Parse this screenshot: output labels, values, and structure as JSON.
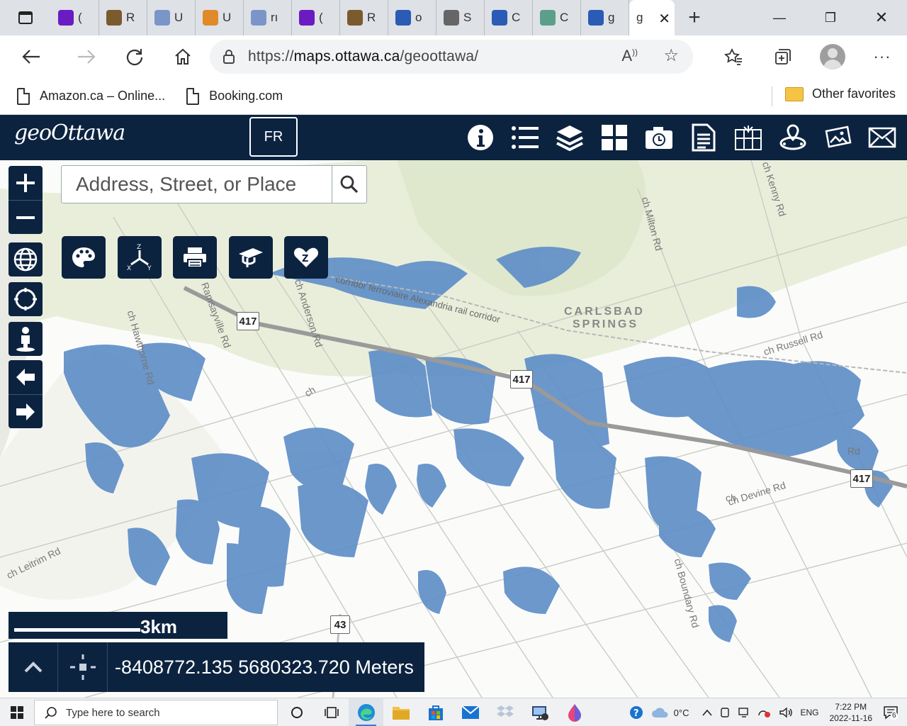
{
  "browser": {
    "tabs": [
      {
        "title": "(",
        "icon": "mail-icon",
        "color": "#6a1bc2"
      },
      {
        "title": "R",
        "icon": "crest-icon",
        "color": "#7b5a2e"
      },
      {
        "title": "U",
        "icon": "search-icon",
        "color": "#7a96c9"
      },
      {
        "title": "U",
        "icon": "sun-icon",
        "color": "#e08a2a"
      },
      {
        "title": "rı",
        "icon": "search-icon",
        "color": "#7a96c9"
      },
      {
        "title": "(",
        "icon": "mail-icon",
        "color": "#6a1bc2"
      },
      {
        "title": "R",
        "icon": "crest-icon",
        "color": "#7b5a2e"
      },
      {
        "title": "o",
        "icon": "search-icon",
        "color": "#2a5bb5"
      },
      {
        "title": "S",
        "icon": "shield-icon",
        "color": "#666666"
      },
      {
        "title": "C",
        "icon": "search-icon",
        "color": "#2a5bb5"
      },
      {
        "title": "C",
        "icon": "map-thumb-icon",
        "color": "#5b9f8a"
      },
      {
        "title": "g",
        "icon": "search-icon",
        "color": "#2a5bb5"
      }
    ],
    "active_tab_title": "g",
    "url_prefix": "https://",
    "url_host": "maps.ottawa.ca",
    "url_path": "/geoottawa/",
    "favorites": [
      {
        "label": "Amazon.ca – Online..."
      },
      {
        "label": "Booking.com"
      }
    ],
    "other_favorites": "Other favorites"
  },
  "app": {
    "logo_a": "geo",
    "logo_b": "Ottawa",
    "lang_button": "FR",
    "search_placeholder": "Address, Street, or Place"
  },
  "map": {
    "labels": {
      "carlsbad": "CARLSBAD",
      "springs": "SPRINGS",
      "hwy417": "417",
      "hwy43": "43",
      "rail": "corridor ferroviaire Alexandria rail corridor",
      "russell": "ch Russell Rd",
      "milton": "ch Milton Rd",
      "kenny": "ch Kenny Rd",
      "boundary": "ch Boundary Rd",
      "devine": "ch Devine Rd",
      "leitrim": "ch Leitrim Rd",
      "ramsayville": "Ramsayville Rd",
      "anderson": "ch Anderson Rd",
      "hawthorne": "ch Hawthorne Rd",
      "rd_generic": "Rd",
      "ch_generic": "ch",
      "ch_generic2": "ch"
    },
    "scale_label": "3km",
    "coordinates": "-8408772.135 5680323.720 Meters"
  },
  "taskbar": {
    "search_placeholder": "Type here to search",
    "temperature": "0°C",
    "language": "ENG",
    "time": "7:22 PM",
    "date": "2022-11-16",
    "notifications": "6"
  }
}
